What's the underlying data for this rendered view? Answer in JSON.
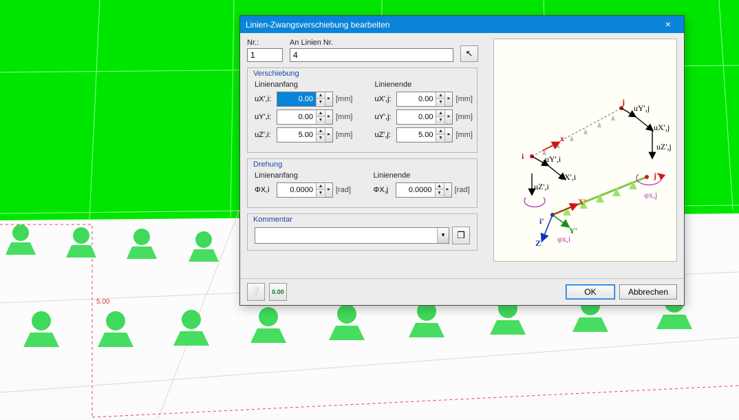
{
  "dialog": {
    "title": "Linien-Zwangsverschiebung bearbeiten",
    "nr_label": "Nr.:",
    "nr_value": "1",
    "on_lines_label": "An Linien Nr.",
    "on_lines_value": "4"
  },
  "groups": {
    "verschiebung": {
      "legend": "Verschiebung",
      "start_head": "Linienanfang",
      "end_head": "Linienende",
      "unit": "[mm]",
      "rows": {
        "ux": {
          "label_i": "uX',i:",
          "label_j": "uX',j:",
          "val_i": "0.00",
          "val_j": "0.00"
        },
        "uy": {
          "label_i": "uY',i:",
          "label_j": "uY',j:",
          "val_i": "0.00",
          "val_j": "0.00"
        },
        "uz": {
          "label_i": "uZ',i:",
          "label_j": "uZ',j:",
          "val_i": "5.00",
          "val_j": "5.00"
        }
      }
    },
    "drehung": {
      "legend": "Drehung",
      "start_head": "Linienanfang",
      "end_head": "Linienende",
      "unit": "[rad]",
      "rows": {
        "phix": {
          "label_i": "ΦX,i",
          "label_j": "ΦX,j",
          "val_i": "0.0000",
          "val_j": "0.0000"
        }
      }
    },
    "kommentar": {
      "legend": "Kommentar",
      "value": ""
    }
  },
  "figure": {
    "labels": {
      "j": "j",
      "i": "i",
      "jp": "j'",
      "ip": "i'",
      "uyj": "uY',j",
      "uxj": "uX',j",
      "uzj": "uZ',j",
      "uyi": "uY',i",
      "uxi": "uX',i",
      "uzi": "uZ',i",
      "phixj": "φx,j",
      "phixi": "φx,i",
      "xp": "X'",
      "yp": "Y'",
      "zp": "Z'",
      "x_red": "x"
    }
  },
  "buttons": {
    "ok": "OK",
    "cancel": "Abbrechen"
  },
  "bg_dim": "5.00"
}
